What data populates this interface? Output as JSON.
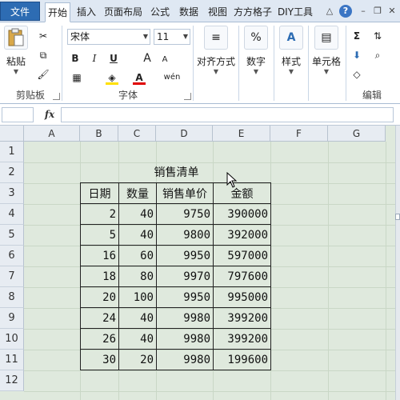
{
  "tabs": [
    {
      "label": "文件"
    },
    {
      "label": "开始"
    },
    {
      "label": "插入"
    },
    {
      "label": "页面布局"
    },
    {
      "label": "公式"
    },
    {
      "label": "数据"
    },
    {
      "label": "视图"
    },
    {
      "label": "方方格子"
    },
    {
      "label": "DIY工具"
    }
  ],
  "ribbon": {
    "paste_label": "粘贴",
    "clipboard_group": "剪贴板",
    "font_name": "宋体",
    "font_size": "11",
    "bold": "B",
    "italic": "I",
    "underline": "U",
    "grow_font": "A",
    "shrink_font": "A",
    "font_color_glyph": "A",
    "phonetic_glyph": "wén",
    "font_group": "字体",
    "align_label": "对齐方式",
    "number_label": "数字",
    "number_glyph": "%",
    "styles_label": "样式",
    "cells_label": "单元格",
    "edit_group": "编辑",
    "sum_glyph": "Σ"
  },
  "formula_bar": {
    "fx_label": "fx",
    "name_box": "",
    "formula": ""
  },
  "columns": [
    "A",
    "B",
    "C",
    "D",
    "E",
    "F",
    "G"
  ],
  "rows": [
    "1",
    "2",
    "3",
    "4",
    "5",
    "6",
    "7",
    "8",
    "9",
    "10",
    "11",
    "12"
  ],
  "sheet": {
    "title": "销售清单",
    "headers": [
      "日期",
      "数量",
      "销售单价",
      "金额"
    ],
    "records": [
      [
        "2",
        "40",
        "9750",
        "390000"
      ],
      [
        "5",
        "40",
        "9800",
        "392000"
      ],
      [
        "16",
        "60",
        "9950",
        "597000"
      ],
      [
        "18",
        "80",
        "9970",
        "797600"
      ],
      [
        "20",
        "100",
        "9950",
        "995000"
      ],
      [
        "24",
        "40",
        "9980",
        "399200"
      ],
      [
        "26",
        "40",
        "9980",
        "399200"
      ],
      [
        "30",
        "20",
        "9980",
        "199600"
      ]
    ]
  },
  "colors": {
    "file_tab": "#2d6cb3",
    "grid_bg": "#dfe9dd",
    "header_bg": "#e7ecf2"
  }
}
